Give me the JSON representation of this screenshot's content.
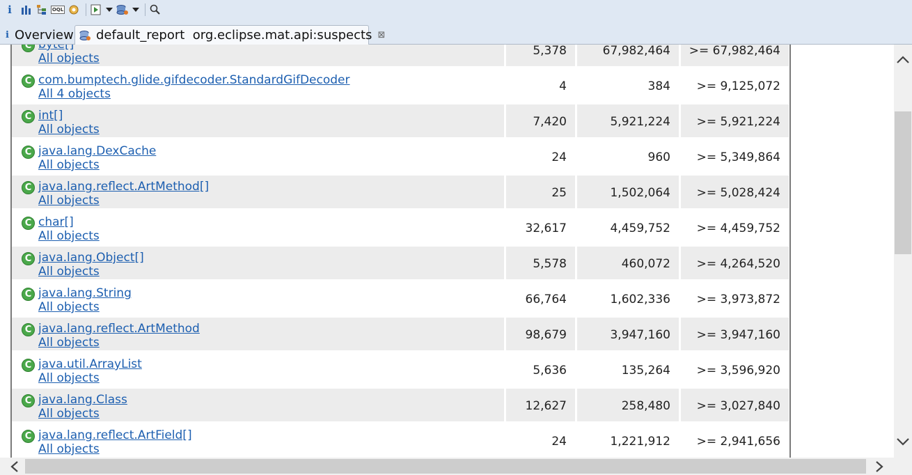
{
  "toolbar": {
    "buttons": [
      "info-icon",
      "histogram-icon",
      "dominator-tree-icon",
      "oql-icon",
      "top-consumers-icon",
      "run-report-icon",
      "dropdown-icon",
      "query-browser-icon",
      "dropdown-icon",
      "search-icon"
    ],
    "info_glyph": "i",
    "oql_glyph": "OQL"
  },
  "tabs": [
    {
      "label": "Overview",
      "active": false,
      "icon_glyph": "i"
    },
    {
      "label": "default_report  org.eclipse.mat.api:suspects",
      "active": true,
      "close_glyph": "⊠"
    }
  ],
  "table": {
    "rows": [
      {
        "class_name": "byte[]",
        "objects_label": "All objects",
        "objects": "5,378",
        "shallow_heap": "67,982,464",
        "retained_heap": ">= 67,982,464"
      },
      {
        "class_name": "com.bumptech.glide.gifdecoder.StandardGifDecoder",
        "objects_label": "All 4 objects",
        "objects": "4",
        "shallow_heap": "384",
        "retained_heap": ">= 9,125,072"
      },
      {
        "class_name": "int[]",
        "objects_label": "All objects",
        "objects": "7,420",
        "shallow_heap": "5,921,224",
        "retained_heap": ">= 5,921,224"
      },
      {
        "class_name": "java.lang.DexCache",
        "objects_label": "All objects",
        "objects": "24",
        "shallow_heap": "960",
        "retained_heap": ">= 5,349,864"
      },
      {
        "class_name": "java.lang.reflect.ArtMethod[]",
        "objects_label": "All objects",
        "objects": "25",
        "shallow_heap": "1,502,064",
        "retained_heap": ">= 5,028,424"
      },
      {
        "class_name": "char[]",
        "objects_label": "All objects",
        "objects": "32,617",
        "shallow_heap": "4,459,752",
        "retained_heap": ">= 4,459,752"
      },
      {
        "class_name": "java.lang.Object[]",
        "objects_label": "All objects",
        "objects": "5,578",
        "shallow_heap": "460,072",
        "retained_heap": ">= 4,264,520"
      },
      {
        "class_name": "java.lang.String",
        "objects_label": "All objects",
        "objects": "66,764",
        "shallow_heap": "1,602,336",
        "retained_heap": ">= 3,973,872"
      },
      {
        "class_name": "java.lang.reflect.ArtMethod",
        "objects_label": "All objects",
        "objects": "98,679",
        "shallow_heap": "3,947,160",
        "retained_heap": ">= 3,947,160"
      },
      {
        "class_name": "java.util.ArrayList",
        "objects_label": "All objects",
        "objects": "5,636",
        "shallow_heap": "135,264",
        "retained_heap": ">= 3,596,920"
      },
      {
        "class_name": "java.lang.Class",
        "objects_label": "All objects",
        "objects": "12,627",
        "shallow_heap": "258,480",
        "retained_heap": ">= 3,027,840"
      },
      {
        "class_name": "java.lang.reflect.ArtField[]",
        "objects_label": "All objects",
        "objects": "24",
        "shallow_heap": "1,221,912",
        "retained_heap": ">= 2,941,656"
      }
    ],
    "class_icon_glyph": "C"
  },
  "colors": {
    "toolbar_bg": "#dfe8f3",
    "link": "#1d5fb0",
    "row_shade": "#ececec",
    "class_icon": "#4aa84a"
  }
}
